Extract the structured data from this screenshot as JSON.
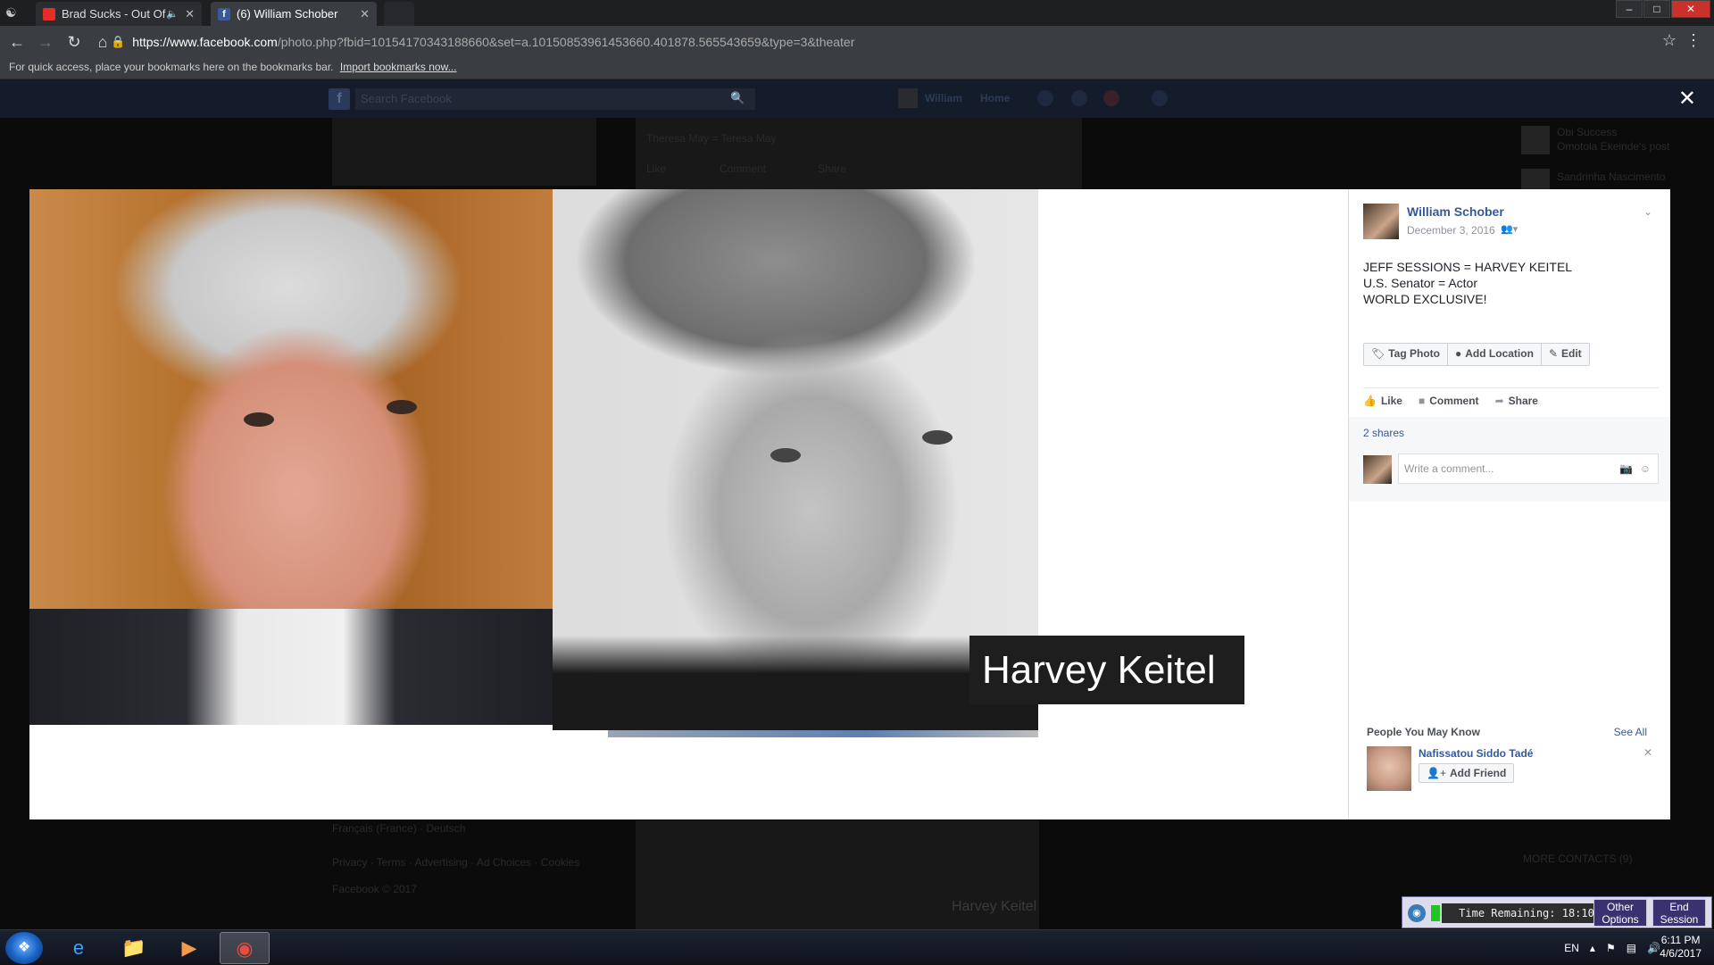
{
  "browser": {
    "tabs": [
      {
        "title": "Brad Sucks - Out Of It",
        "favicon": "youtube-icon"
      },
      {
        "title": "(6) William Schober",
        "favicon": "facebook-icon"
      }
    ],
    "url_host": "https://www.facebook.com",
    "url_path": "/photo.php?fbid=10154170343188660&set=a.10150853961453660.401878.565543659&type=3&theater",
    "bookmarks_hint": "For quick access, place your bookmarks here on the bookmarks bar.",
    "bookmarks_link": "Import bookmarks now..."
  },
  "fb_bar": {
    "search_placeholder": "Search Facebook",
    "user": "William",
    "home": "Home"
  },
  "background_page": {
    "snippet_1": "Theresa May = Teresa May",
    "like": "Like",
    "comment": "Comment",
    "share": "Share",
    "sidebar_1_name": "Obi Success",
    "sidebar_1_note": "Omotola Ekeinde's post",
    "sidebar_2_name": "Sandrinha Nascimento",
    "footer_lang": "Français (France) · Deutsch",
    "footer_links": "Privacy · Terms · Advertising · Ad Choices · Cookies",
    "footer_copy": "Facebook © 2017",
    "more_contacts": "MORE CONTACTS (9)",
    "bottom_caption": "Harvey Keitel"
  },
  "photo": {
    "caption": "Harvey Keitel"
  },
  "post": {
    "author": "William Schober",
    "date": "December 3, 2016",
    "body_line_1": "JEFF SESSIONS = HARVEY KEITEL",
    "body_line_2": "U.S. Senator = Actor",
    "body_line_3": "WORLD EXCLUSIVE!",
    "tag_photo": "Tag Photo",
    "add_location": "Add Location",
    "edit": "Edit",
    "like": "Like",
    "comment": "Comment",
    "share": "Share",
    "shares_count": "2 shares",
    "comment_placeholder": "Write a comment..."
  },
  "pymk": {
    "title": "People You May Know",
    "see_all": "See All",
    "person_name": "Nafissatou Siddo Tadé",
    "add_friend": "Add Friend"
  },
  "session": {
    "time_remaining": "Time Remaining: 18:10",
    "other_options_1": "Other",
    "other_options_2": "Options",
    "end_session_1": "End",
    "end_session_2": "Session"
  },
  "taskbar": {
    "lang": "EN",
    "time": "6:11 PM",
    "date": "4/6/2017"
  }
}
